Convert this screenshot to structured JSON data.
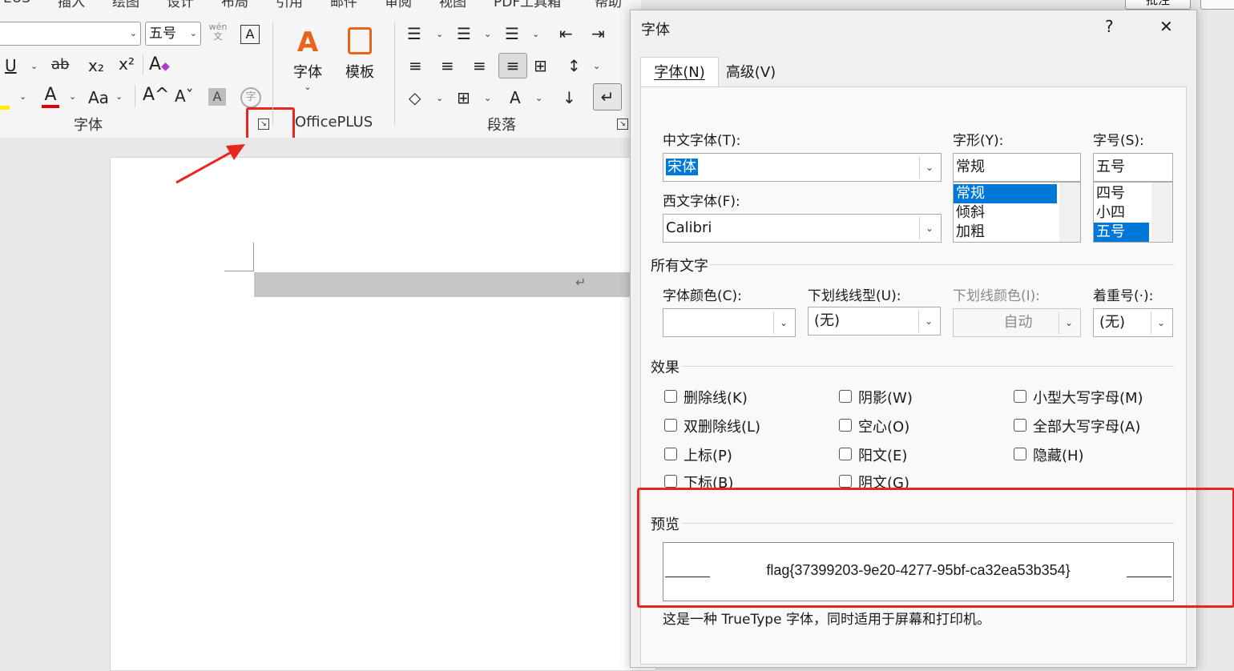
{
  "ribbon": {
    "tabs": [
      "EUS",
      "插入",
      "绘图",
      "设计",
      "布局",
      "引用",
      "邮件",
      "审阅",
      "视图",
      "PDF工具箱",
      "帮助"
    ],
    "font_size_value": "五号",
    "font_group_label": "字体",
    "officeplus_font_label": "字体",
    "officeplus_template_label": "模板",
    "officeplus_group_label": "OfficePLUS",
    "paragraph_group_label": "段落",
    "icons": {
      "underline": "U",
      "strike": "ab",
      "subscript": "x₂",
      "superscript": "x²",
      "font_color": "A",
      "change_case": "Aa",
      "grow": "A^",
      "shrink": "Aˇ",
      "shading": "A",
      "enclose": "字",
      "wen": "wén",
      "wen_sub": "文",
      "char_border": "A"
    },
    "right_edge_button": "批注"
  },
  "dialog": {
    "title": "字体",
    "help": "?",
    "close": "✕",
    "tabs": [
      "字体(N)",
      "高级(V)"
    ],
    "cn_font_label": "中文字体(T):",
    "cn_font_value": "宋体",
    "west_font_label": "西文字体(F):",
    "west_font_value": "Calibri",
    "style_label": "字形(Y):",
    "style_value": "常规",
    "style_options": [
      "常规",
      "倾斜",
      "加粗"
    ],
    "size_label": "字号(S):",
    "size_value": "五号",
    "size_options": [
      "四号",
      "小四",
      "五号"
    ],
    "all_text_section": "所有文字",
    "font_color_label": "字体颜色(C):",
    "underline_style_label": "下划线线型(U):",
    "underline_style_value": "(无)",
    "underline_color_label": "下划线颜色(I):",
    "underline_color_value": "自动",
    "emphasis_label": "着重号(·):",
    "emphasis_value": "(无)",
    "effects_section": "效果",
    "effects": [
      [
        "删除线(K)",
        "阴影(W)",
        "小型大写字母(M)"
      ],
      [
        "双删除线(L)",
        "空心(O)",
        "全部大写字母(A)"
      ],
      [
        "上标(P)",
        "阳文(E)",
        "隐藏(H)"
      ],
      [
        "下标(B)",
        "阴文(G)"
      ]
    ],
    "preview_section": "预览",
    "preview_text": "flag{37399203-9e20-4277-95bf-ca32ea53b354}",
    "footer_note": "这是一种 TrueType 字体，同时适用于屏幕和打印机。"
  },
  "colors": {
    "highlight_red": "#e8261f",
    "selection_blue": "#0078d7",
    "accent_orange": "#e8641a"
  }
}
